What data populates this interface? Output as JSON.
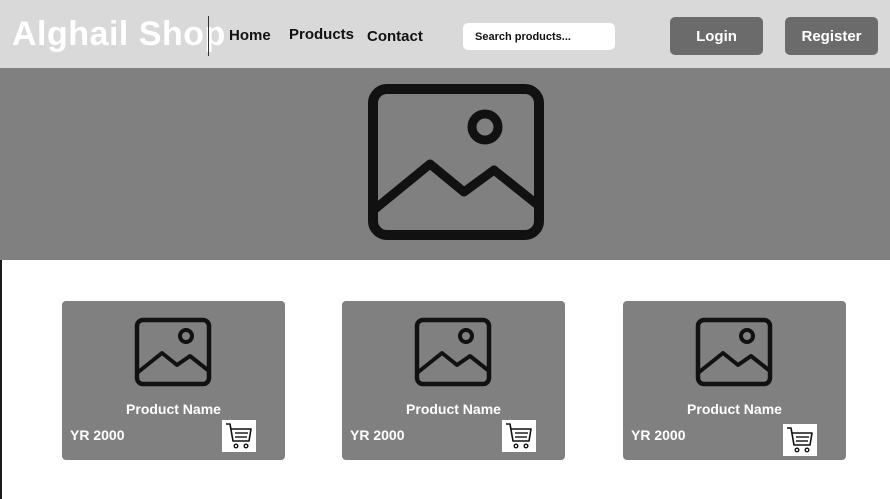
{
  "header": {
    "brand": "Alghail Shop",
    "nav": {
      "home": "Home",
      "products": "Products",
      "contact": "Contact"
    },
    "search_placeholder": "Search products...",
    "login_label": "Login",
    "register_label": "Register"
  },
  "hero": {
    "icon": "image-placeholder-icon"
  },
  "products": [
    {
      "name": "Product Name",
      "price": "YR 2000",
      "image_icon": "image-placeholder-icon",
      "cart_icon": "shopping-cart-icon"
    },
    {
      "name": "Product Name",
      "price": "YR 2000",
      "image_icon": "image-placeholder-icon",
      "cart_icon": "shopping-cart-icon"
    },
    {
      "name": "Product Name",
      "price": "YR 2000",
      "image_icon": "image-placeholder-icon",
      "cart_icon": "shopping-cart-icon"
    }
  ],
  "colors": {
    "header_bg": "#d9d9d9",
    "hero_bg": "#808080",
    "card_bg": "#808080",
    "button_bg": "#6b6b6b",
    "brand_text": "#ffffff"
  }
}
